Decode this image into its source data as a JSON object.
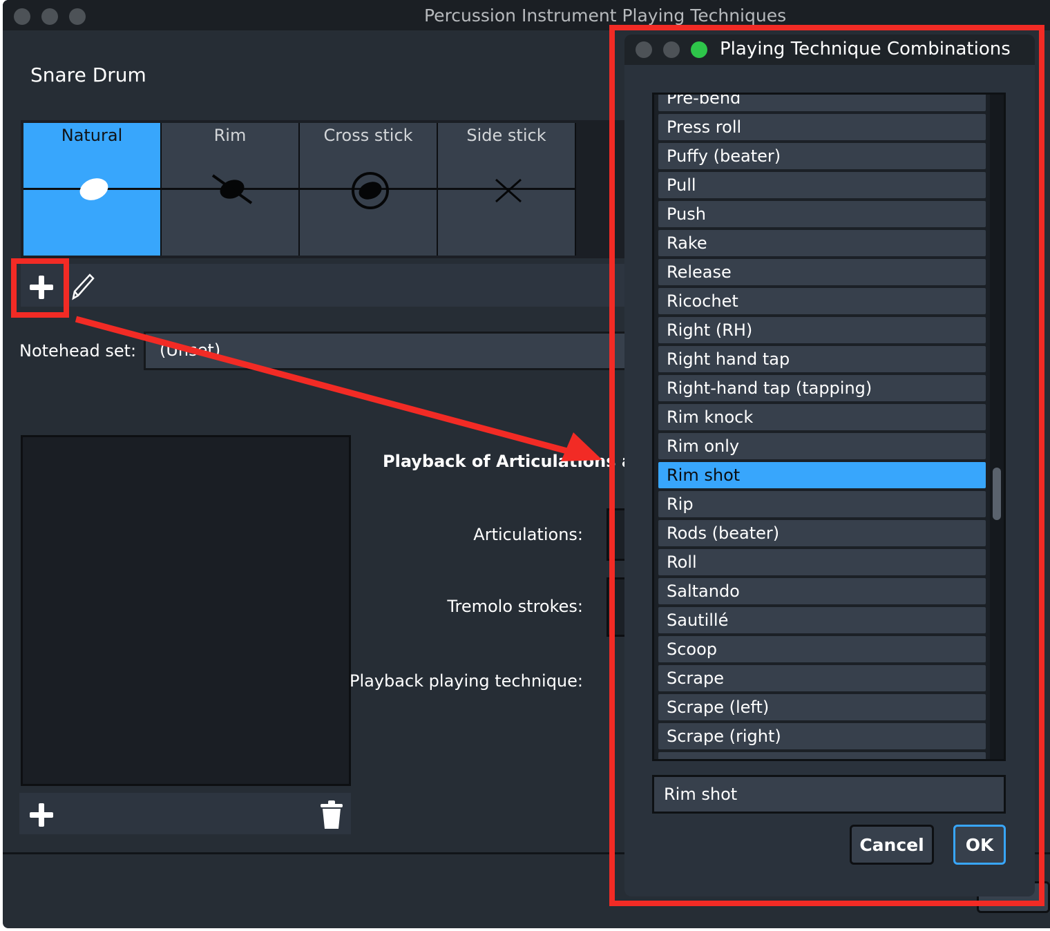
{
  "main_window": {
    "title": "Percussion Instrument Playing Techniques",
    "instrument_name": "Snare Drum",
    "techniques": [
      {
        "label": "Natural",
        "selected": true
      },
      {
        "label": "Rim",
        "selected": false
      },
      {
        "label": "Cross stick",
        "selected": false
      },
      {
        "label": "Side stick",
        "selected": false
      }
    ],
    "notehead_label": "Notehead set:",
    "notehead_value": "(Unset)",
    "playback_heading": "Playback of Articulations and Tr",
    "articulations_label": "Articulations:",
    "tremolo_label": "Tremolo strokes:",
    "playback_technique_label": "Playback playing technique:"
  },
  "dialog": {
    "title": "Playing Technique Combinations",
    "items": [
      "Pre-bend",
      "Press roll",
      "Puffy (beater)",
      "Pull",
      "Push",
      "Rake",
      "Release",
      "Ricochet",
      "Right (RH)",
      "Right hand tap",
      "Right-hand tap (tapping)",
      "Rim knock",
      "Rim only",
      "Rim shot",
      "Rip",
      "Rods (beater)",
      "Roll",
      "Saltando",
      "Sautillé",
      "Scoop",
      "Scrape",
      "Scrape (left)",
      "Scrape (right)",
      ""
    ],
    "selected_item": "Rim shot",
    "name_value": "Rim shot",
    "cancel_label": "Cancel",
    "ok_label": "OK"
  },
  "colors": {
    "accent": "#38a6fc",
    "annotation": "#f22b25",
    "window_bg": "#262d35"
  }
}
